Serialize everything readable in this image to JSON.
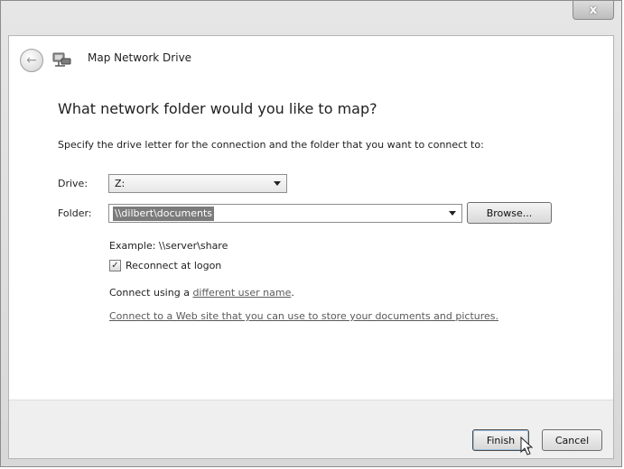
{
  "window": {
    "title": "Map Network Drive",
    "close_label": "x"
  },
  "icons": {
    "back": "back-arrow-icon",
    "wizard": "network-drive-icon",
    "close": "close-icon",
    "checkbox_check": "✓",
    "cursor": "mouse-pointer-icon"
  },
  "main": {
    "heading": "What network folder would you like to map?",
    "instruction": "Specify the drive letter for the connection and the folder that you want to connect to:",
    "drive_label": "Drive:",
    "drive_value": "Z:",
    "folder_label": "Folder:",
    "folder_value": "\\\\dilbert\\documents",
    "browse_label": "Browse...",
    "example": "Example: \\\\server\\share",
    "reconnect_label": "Reconnect at logon",
    "reconnect_checked": true,
    "connect_prefix": "Connect using a ",
    "connect_link": "different user name",
    "connect_suffix": ".",
    "web_link": "Connect to a Web site that you can use to store your documents and pictures."
  },
  "footer": {
    "finish_label": "Finish",
    "cancel_label": "Cancel"
  },
  "colors": {
    "link": "#5a5a5a",
    "selection": "#7b7b7b"
  }
}
